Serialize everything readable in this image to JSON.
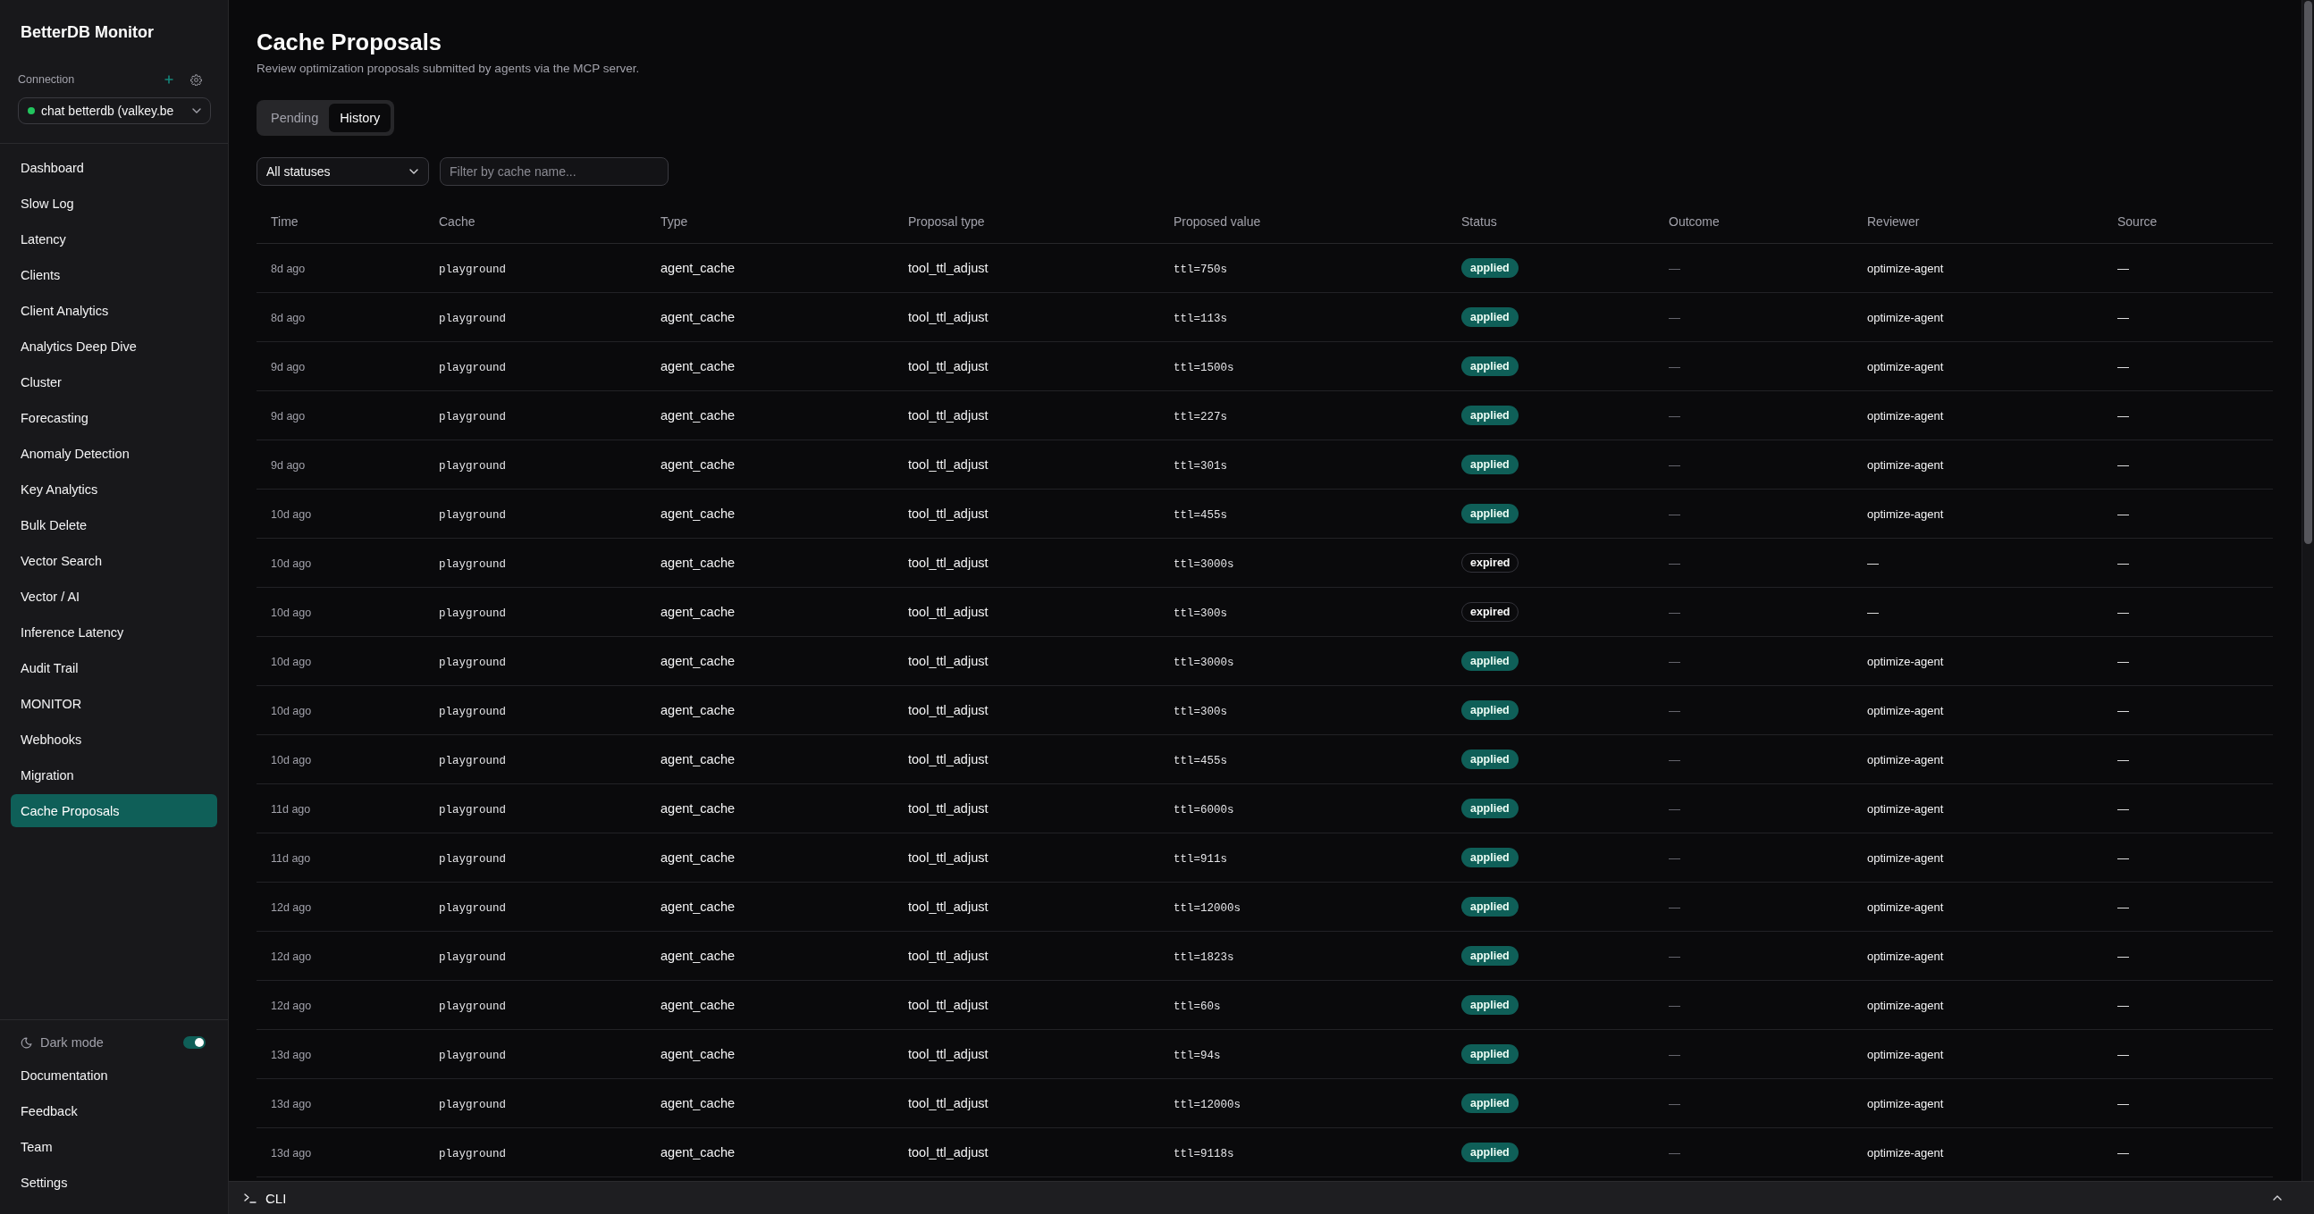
{
  "sidebar": {
    "app_title": "BetterDB Monitor",
    "connection": {
      "label": "Connection",
      "selected_connection": "chat betterdb (valkey.be",
      "connected": true
    },
    "nav_items": [
      {
        "label": "Dashboard",
        "selected": false
      },
      {
        "label": "Slow Log",
        "selected": false
      },
      {
        "label": "Latency",
        "selected": false
      },
      {
        "label": "Clients",
        "selected": false
      },
      {
        "label": "Client Analytics",
        "selected": false
      },
      {
        "label": "Analytics Deep Dive",
        "selected": false
      },
      {
        "label": "Cluster",
        "selected": false
      },
      {
        "label": "Forecasting",
        "selected": false
      },
      {
        "label": "Anomaly Detection",
        "selected": false
      },
      {
        "label": "Key Analytics",
        "selected": false
      },
      {
        "label": "Bulk Delete",
        "selected": false
      },
      {
        "label": "Vector Search",
        "selected": false
      },
      {
        "label": "Vector / AI",
        "selected": false
      },
      {
        "label": "Inference Latency",
        "selected": false
      },
      {
        "label": "Audit Trail",
        "selected": false
      },
      {
        "label": "MONITOR",
        "selected": false
      },
      {
        "label": "Webhooks",
        "selected": false
      },
      {
        "label": "Migration",
        "selected": false
      },
      {
        "label": "Cache Proposals",
        "selected": true
      }
    ],
    "dark_mode": {
      "label": "Dark mode",
      "on": true
    },
    "footer_links": [
      "Documentation",
      "Feedback",
      "Team",
      "Settings"
    ]
  },
  "page": {
    "title": "Cache Proposals",
    "subtitle": "Review optimization proposals submitted by agents via the MCP server."
  },
  "tabs": [
    {
      "label": "Pending",
      "selected": false
    },
    {
      "label": "History",
      "selected": true
    }
  ],
  "filters": {
    "status_select": "All statuses",
    "cache_search": {
      "placeholder": "Filter by cache name..."
    }
  },
  "table": {
    "columns": [
      "Time",
      "Cache",
      "Type",
      "Proposal type",
      "Proposed value",
      "Status",
      "Outcome",
      "Reviewer",
      "Source"
    ],
    "rows": [
      {
        "time": "8d ago",
        "cache": "playground",
        "type": "agent_cache",
        "proposal_type": "tool_ttl_adjust",
        "proposed_value": "ttl=750s",
        "status": {
          "label": "applied",
          "kind": "applied"
        },
        "outcome": "—",
        "reviewer": "optimize-agent",
        "source": "—"
      },
      {
        "time": "8d ago",
        "cache": "playground",
        "type": "agent_cache",
        "proposal_type": "tool_ttl_adjust",
        "proposed_value": "ttl=113s",
        "status": {
          "label": "applied",
          "kind": "applied"
        },
        "outcome": "—",
        "reviewer": "optimize-agent",
        "source": "—"
      },
      {
        "time": "9d ago",
        "cache": "playground",
        "type": "agent_cache",
        "proposal_type": "tool_ttl_adjust",
        "proposed_value": "ttl=1500s",
        "status": {
          "label": "applied",
          "kind": "applied"
        },
        "outcome": "—",
        "reviewer": "optimize-agent",
        "source": "—"
      },
      {
        "time": "9d ago",
        "cache": "playground",
        "type": "agent_cache",
        "proposal_type": "tool_ttl_adjust",
        "proposed_value": "ttl=227s",
        "status": {
          "label": "applied",
          "kind": "applied"
        },
        "outcome": "—",
        "reviewer": "optimize-agent",
        "source": "—"
      },
      {
        "time": "9d ago",
        "cache": "playground",
        "type": "agent_cache",
        "proposal_type": "tool_ttl_adjust",
        "proposed_value": "ttl=301s",
        "status": {
          "label": "applied",
          "kind": "applied"
        },
        "outcome": "—",
        "reviewer": "optimize-agent",
        "source": "—"
      },
      {
        "time": "10d ago",
        "cache": "playground",
        "type": "agent_cache",
        "proposal_type": "tool_ttl_adjust",
        "proposed_value": "ttl=455s",
        "status": {
          "label": "applied",
          "kind": "applied"
        },
        "outcome": "—",
        "reviewer": "optimize-agent",
        "source": "—"
      },
      {
        "time": "10d ago",
        "cache": "playground",
        "type": "agent_cache",
        "proposal_type": "tool_ttl_adjust",
        "proposed_value": "ttl=3000s",
        "status": {
          "label": "expired",
          "kind": "expired"
        },
        "outcome": "—",
        "reviewer": "—",
        "source": "—"
      },
      {
        "time": "10d ago",
        "cache": "playground",
        "type": "agent_cache",
        "proposal_type": "tool_ttl_adjust",
        "proposed_value": "ttl=300s",
        "status": {
          "label": "expired",
          "kind": "expired"
        },
        "outcome": "—",
        "reviewer": "—",
        "source": "—"
      },
      {
        "time": "10d ago",
        "cache": "playground",
        "type": "agent_cache",
        "proposal_type": "tool_ttl_adjust",
        "proposed_value": "ttl=3000s",
        "status": {
          "label": "applied",
          "kind": "applied"
        },
        "outcome": "—",
        "reviewer": "optimize-agent",
        "source": "—"
      },
      {
        "time": "10d ago",
        "cache": "playground",
        "type": "agent_cache",
        "proposal_type": "tool_ttl_adjust",
        "proposed_value": "ttl=300s",
        "status": {
          "label": "applied",
          "kind": "applied"
        },
        "outcome": "—",
        "reviewer": "optimize-agent",
        "source": "—"
      },
      {
        "time": "10d ago",
        "cache": "playground",
        "type": "agent_cache",
        "proposal_type": "tool_ttl_adjust",
        "proposed_value": "ttl=455s",
        "status": {
          "label": "applied",
          "kind": "applied"
        },
        "outcome": "—",
        "reviewer": "optimize-agent",
        "source": "—"
      },
      {
        "time": "11d ago",
        "cache": "playground",
        "type": "agent_cache",
        "proposal_type": "tool_ttl_adjust",
        "proposed_value": "ttl=6000s",
        "status": {
          "label": "applied",
          "kind": "applied"
        },
        "outcome": "—",
        "reviewer": "optimize-agent",
        "source": "—"
      },
      {
        "time": "11d ago",
        "cache": "playground",
        "type": "agent_cache",
        "proposal_type": "tool_ttl_adjust",
        "proposed_value": "ttl=911s",
        "status": {
          "label": "applied",
          "kind": "applied"
        },
        "outcome": "—",
        "reviewer": "optimize-agent",
        "source": "—"
      },
      {
        "time": "12d ago",
        "cache": "playground",
        "type": "agent_cache",
        "proposal_type": "tool_ttl_adjust",
        "proposed_value": "ttl=12000s",
        "status": {
          "label": "applied",
          "kind": "applied"
        },
        "outcome": "—",
        "reviewer": "optimize-agent",
        "source": "—"
      },
      {
        "time": "12d ago",
        "cache": "playground",
        "type": "agent_cache",
        "proposal_type": "tool_ttl_adjust",
        "proposed_value": "ttl=1823s",
        "status": {
          "label": "applied",
          "kind": "applied"
        },
        "outcome": "—",
        "reviewer": "optimize-agent",
        "source": "—"
      },
      {
        "time": "12d ago",
        "cache": "playground",
        "type": "agent_cache",
        "proposal_type": "tool_ttl_adjust",
        "proposed_value": "ttl=60s",
        "status": {
          "label": "applied",
          "kind": "applied"
        },
        "outcome": "—",
        "reviewer": "optimize-agent",
        "source": "—"
      },
      {
        "time": "13d ago",
        "cache": "playground",
        "type": "agent_cache",
        "proposal_type": "tool_ttl_adjust",
        "proposed_value": "ttl=94s",
        "status": {
          "label": "applied",
          "kind": "applied"
        },
        "outcome": "—",
        "reviewer": "optimize-agent",
        "source": "—"
      },
      {
        "time": "13d ago",
        "cache": "playground",
        "type": "agent_cache",
        "proposal_type": "tool_ttl_adjust",
        "proposed_value": "ttl=12000s",
        "status": {
          "label": "applied",
          "kind": "applied"
        },
        "outcome": "—",
        "reviewer": "optimize-agent",
        "source": "—"
      },
      {
        "time": "13d ago",
        "cache": "playground",
        "type": "agent_cache",
        "proposal_type": "tool_ttl_adjust",
        "proposed_value": "ttl=9118s",
        "status": {
          "label": "applied",
          "kind": "applied"
        },
        "outcome": "—",
        "reviewer": "optimize-agent",
        "source": "—"
      }
    ]
  },
  "cli_bar": {
    "label": "CLI"
  }
}
